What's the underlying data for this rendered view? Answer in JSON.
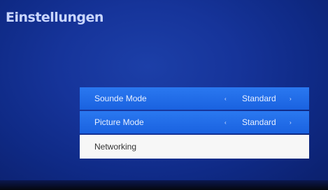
{
  "header": {
    "title": "Einstellungen"
  },
  "menu": {
    "items": [
      {
        "label": "Sounde Mode",
        "value": "Standard",
        "left_arrow": "‹",
        "right_arrow": "›"
      },
      {
        "label": "Picture Mode",
        "value": "Standard",
        "left_arrow": "‹",
        "right_arrow": "›"
      },
      {
        "label": "Networking"
      }
    ]
  },
  "colors": {
    "background": "#16349a",
    "row_blue": "#1f6ae6",
    "row_selected": "#f7f7f7",
    "title_text": "#c9d6ff"
  },
  "icons": {
    "left": "chevron-left-icon",
    "right": "chevron-right-icon"
  }
}
